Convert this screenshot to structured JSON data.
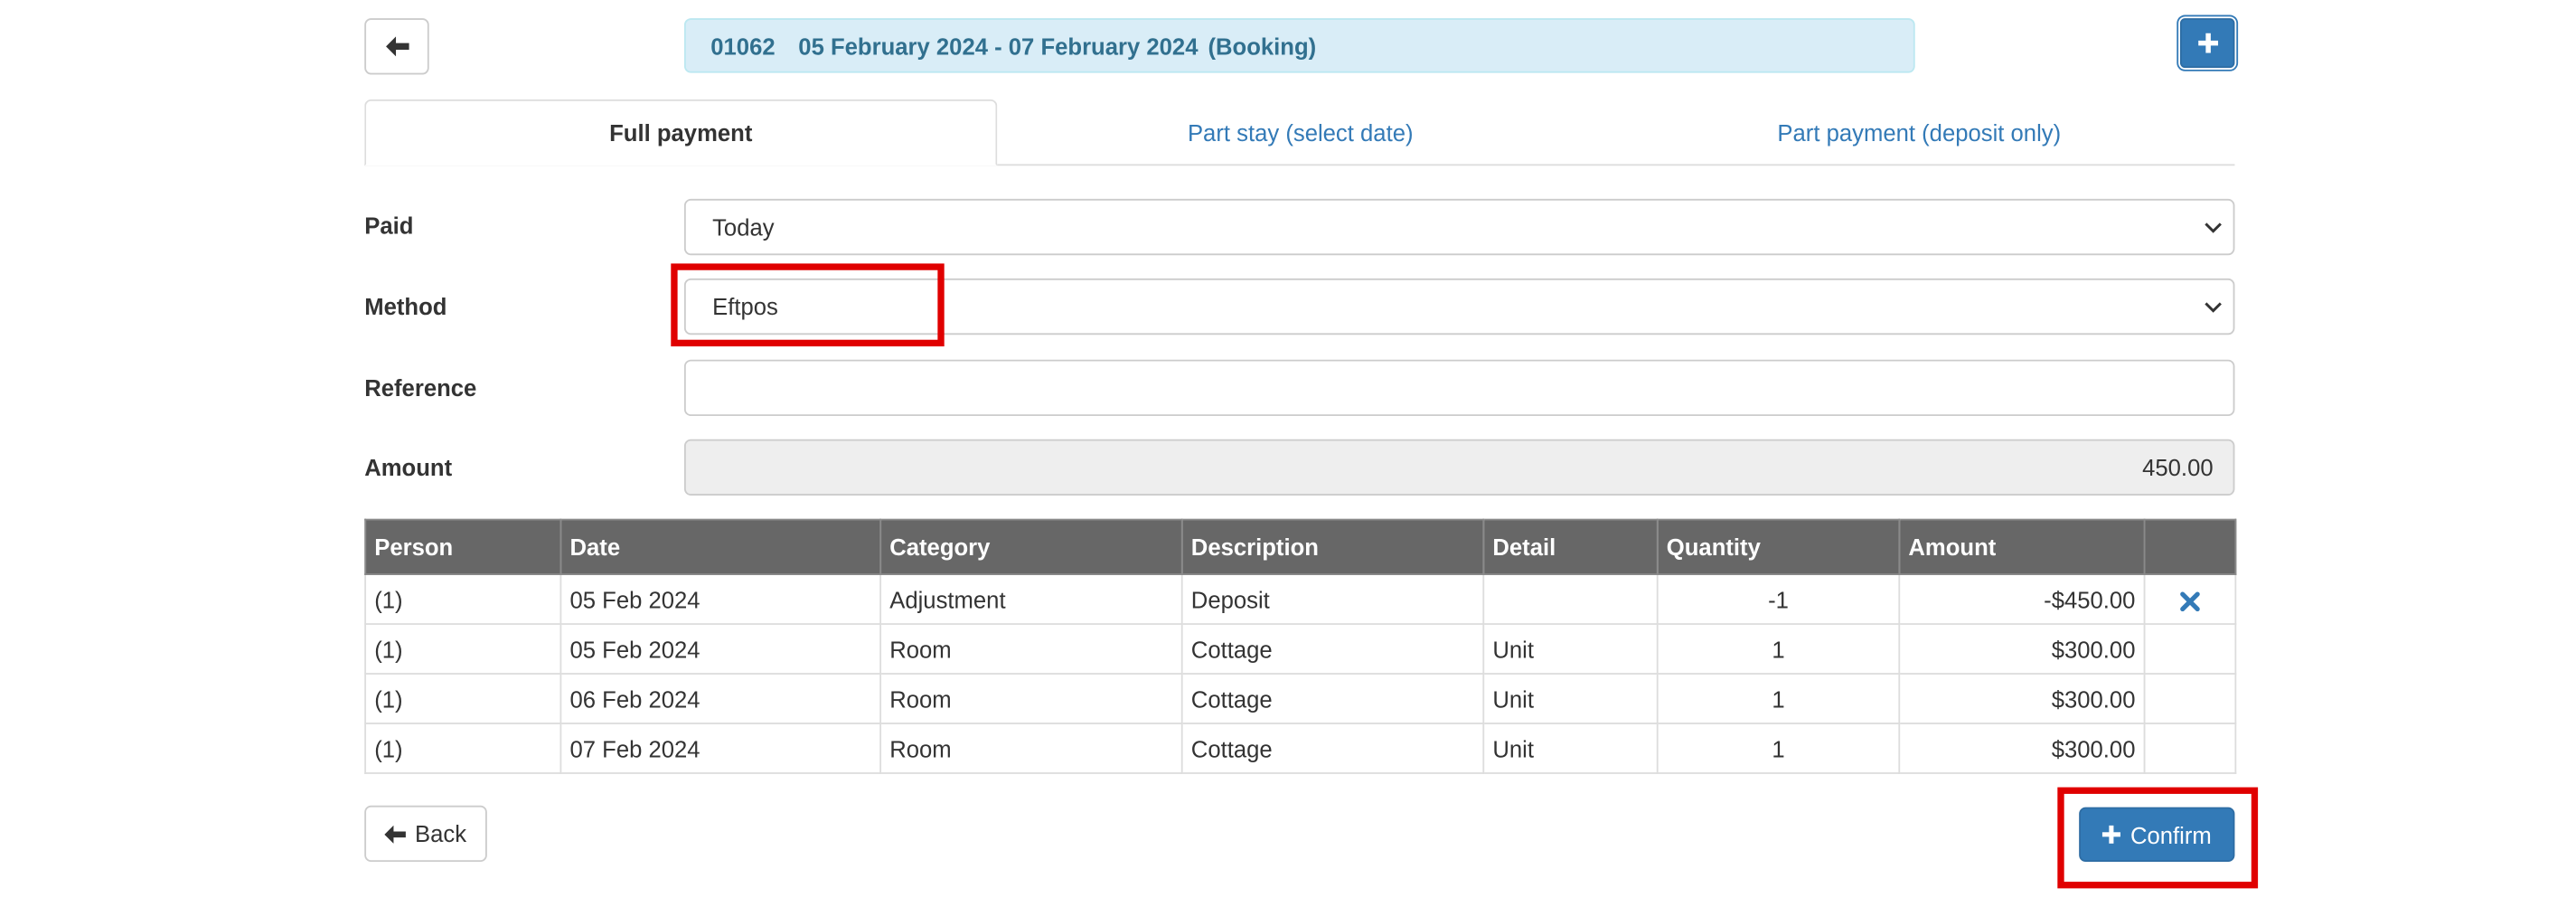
{
  "header": {
    "booking_id": "01062",
    "date_range": "05 February 2024 - 07 February 2024",
    "booking_type": "(Booking)"
  },
  "tabs": [
    {
      "label": "Full payment",
      "active": true
    },
    {
      "label": "Part stay (select date)",
      "active": false
    },
    {
      "label": "Part payment (deposit only)",
      "active": false
    }
  ],
  "form": {
    "paid": {
      "label": "Paid",
      "value": "Today"
    },
    "method": {
      "label": "Method",
      "value": "Eftpos"
    },
    "reference": {
      "label": "Reference",
      "value": ""
    },
    "amount": {
      "label": "Amount",
      "value": "450.00"
    }
  },
  "table": {
    "columns": [
      "Person",
      "Date",
      "Category",
      "Description",
      "Detail",
      "Quantity",
      "Amount",
      ""
    ],
    "rows": [
      {
        "person": "(1)",
        "date": "05 Feb 2024",
        "category": "Adjustment",
        "description": "Deposit",
        "detail": "",
        "quantity": "-1",
        "amount": "-$450.00",
        "removable": true
      },
      {
        "person": "(1)",
        "date": "05 Feb 2024",
        "category": "Room",
        "description": "Cottage",
        "detail": "Unit",
        "quantity": "1",
        "amount": "$300.00",
        "removable": false
      },
      {
        "person": "(1)",
        "date": "06 Feb 2024",
        "category": "Room",
        "description": "Cottage",
        "detail": "Unit",
        "quantity": "1",
        "amount": "$300.00",
        "removable": false
      },
      {
        "person": "(1)",
        "date": "07 Feb 2024",
        "category": "Room",
        "description": "Cottage",
        "detail": "Unit",
        "quantity": "1",
        "amount": "$300.00",
        "removable": false
      }
    ]
  },
  "buttons": {
    "back_label": "Back",
    "confirm_label": "Confirm"
  },
  "icons": {
    "back": "arrow-left-icon",
    "add": "plus-icon",
    "remove": "times-icon",
    "confirm": "plus-icon",
    "dropdown": "chevron-down-icon"
  },
  "colors": {
    "primary": "#337ab7",
    "banner_bg": "#d9edf7",
    "banner_text": "#31708f",
    "table_header": "#676767",
    "highlight": "#e00000"
  }
}
